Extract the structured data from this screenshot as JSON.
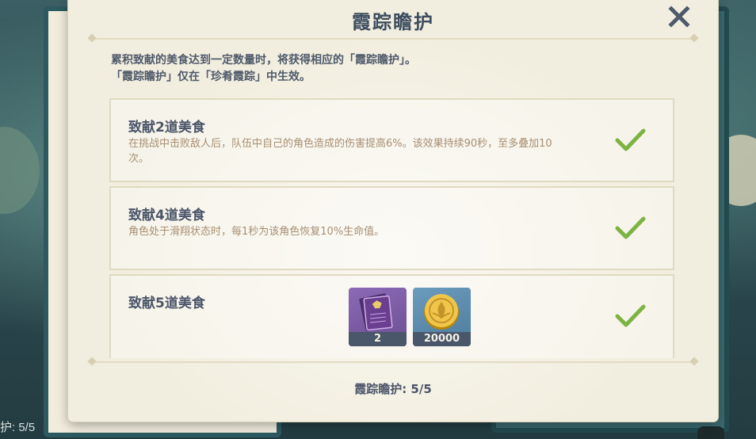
{
  "background": {
    "counter_text": "护: 5/5"
  },
  "dialog": {
    "title": "霞踪瞻护",
    "close_icon": "close-x-icon",
    "description_line1": "累积致献的美食达到一定数量时，将获得相应的「霞踪瞻护」。",
    "description_line2": "「霞踪瞻护」仅在「珍肴霞踪」中生效。",
    "tiers": [
      {
        "title": "致献2道美食",
        "text": "在挑战中击败敌人后，队伍中自己的角色造成的伤害提高6%。该效果持续90秒，至多叠加10次。",
        "completed": true
      },
      {
        "title": "致献4道美食",
        "text": "角色处于滑翔状态时，每1秒为该角色恢复10%生命值。",
        "completed": true
      },
      {
        "title": "致献5道美食",
        "text": "",
        "completed": true,
        "rewards": [
          {
            "icon": "purple-book-icon",
            "count": "2"
          },
          {
            "icon": "mora-coin-icon",
            "count": "20000"
          }
        ]
      }
    ],
    "footer": "霞踪瞻护: 5/5",
    "colors": {
      "title": "#3d4d5f",
      "check": "#7cb342",
      "panel_bg": "#f2eedf",
      "tier_text": "#a88f72"
    }
  }
}
